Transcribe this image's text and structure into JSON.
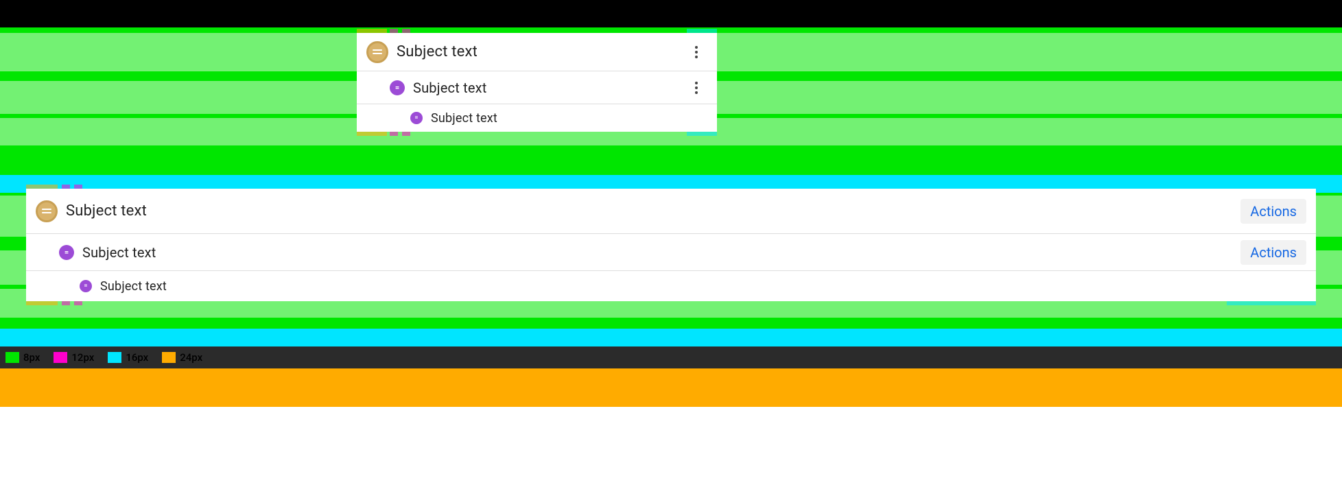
{
  "legend": {
    "items": [
      {
        "color": "green",
        "label": "8px"
      },
      {
        "color": "magenta",
        "label": "12px"
      },
      {
        "color": "cyan",
        "label": "16px"
      },
      {
        "color": "orange",
        "label": "24px"
      }
    ]
  },
  "lists": {
    "compact": {
      "rows": [
        {
          "level": 0,
          "subject": "Subject text",
          "avatar": "large",
          "trailing": "kebab"
        },
        {
          "level": 1,
          "subject": "Subject text",
          "avatar": "medium",
          "trailing": "kebab"
        },
        {
          "level": 2,
          "subject": "Subject text",
          "avatar": "small",
          "trailing": "none"
        }
      ]
    },
    "wide": {
      "rows": [
        {
          "level": 0,
          "subject": "Subject text",
          "avatar": "large",
          "trailing": "actions"
        },
        {
          "level": 1,
          "subject": "Subject text",
          "avatar": "medium",
          "trailing": "actions"
        },
        {
          "level": 2,
          "subject": "Subject text",
          "avatar": "small",
          "trailing": "none"
        }
      ],
      "actions_label": "Actions"
    }
  }
}
